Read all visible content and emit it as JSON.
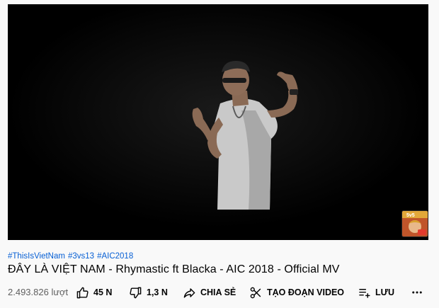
{
  "video": {
    "hashtags": [
      "#ThisIsVietNam",
      "#3vs13",
      "#AIC2018"
    ],
    "title": "ĐÂY LÀ VIỆT NAM - Rhymastic ft Blacka - AIC 2018 - Official MV",
    "views": "2.493.826 lượt"
  },
  "actions": {
    "like": {
      "icon": "thumbs-up-icon",
      "label": "45 N"
    },
    "dislike": {
      "icon": "thumbs-down-icon",
      "label": "1,3 N"
    },
    "share": {
      "icon": "share-icon",
      "label": "CHIA SẺ"
    },
    "clip": {
      "icon": "scissors-icon",
      "label": "TẠO ĐOẠN VIDEO"
    },
    "save": {
      "icon": "playlist-add-icon",
      "label": "LƯU"
    },
    "more": {
      "icon": "more-horizontal-icon"
    }
  },
  "colors": {
    "link": "#065fd4",
    "text": "#030303",
    "secondary": "#606060",
    "background": "#f9f9f9"
  }
}
